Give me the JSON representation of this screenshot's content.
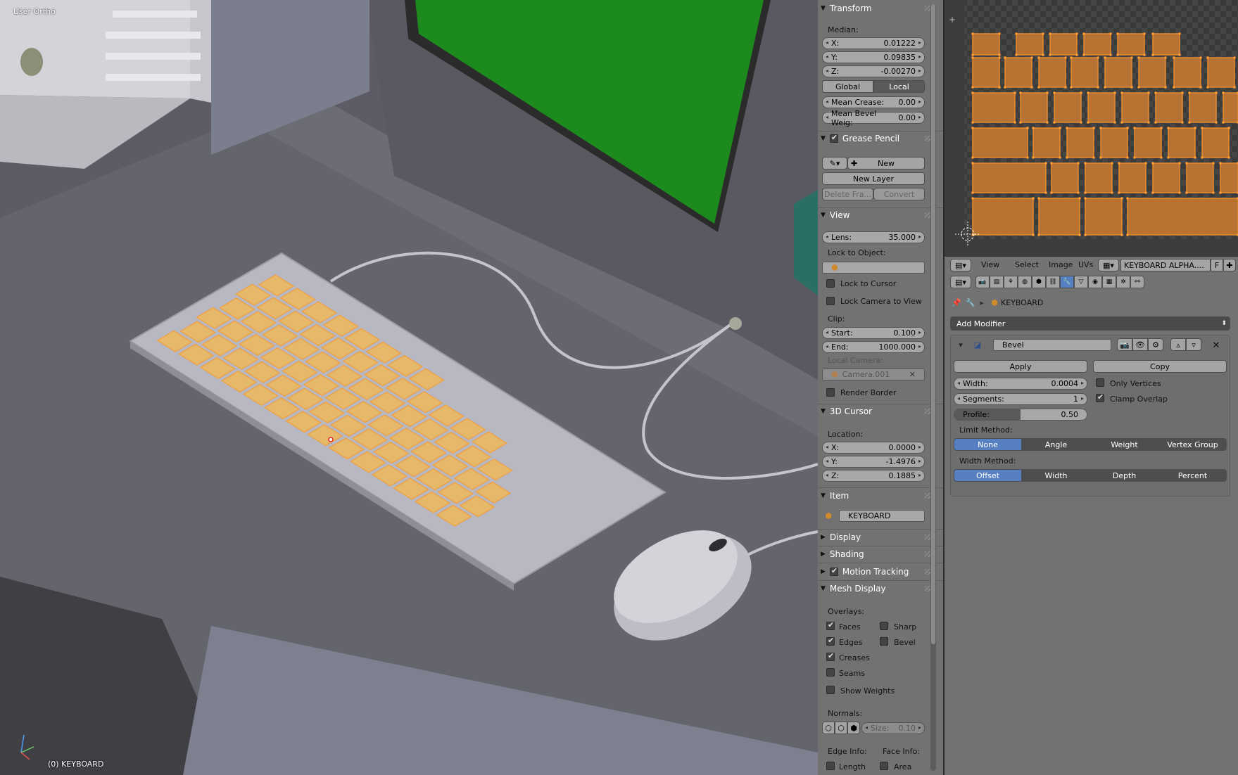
{
  "viewport": {
    "view_name": "User Ortho",
    "object_label": "(0) KEYBOARD"
  },
  "transform": {
    "header": "Transform",
    "median_label": "Median:",
    "x_label": "X:",
    "x_value": "0.01222",
    "y_label": "Y:",
    "y_value": "0.09835",
    "z_label": "Z:",
    "z_value": "-0.00270",
    "global_label": "Global",
    "local_label": "Local",
    "mean_crease_label": "Mean Crease:",
    "mean_crease_value": "0.00",
    "mean_bevel_label": "Mean Bevel Weig:",
    "mean_bevel_value": "0.00"
  },
  "grease_pencil": {
    "header": "Grease Pencil",
    "new_label": "New",
    "new_layer_label": "New Layer",
    "delete_frame_label": "Delete Fra...",
    "convert_label": "Convert"
  },
  "view_panel": {
    "header": "View",
    "lens_label": "Lens:",
    "lens_value": "35.000",
    "lock_to_object_label": "Lock to Object:",
    "lock_to_cursor_label": "Lock to Cursor",
    "lock_camera_label": "Lock Camera to View",
    "clip_label": "Clip:",
    "start_label": "Start:",
    "start_value": "0.100",
    "end_label": "End:",
    "end_value": "1000.000",
    "local_camera_label": "Local Camera:",
    "local_camera_value": "Camera.001",
    "render_border_label": "Render Border"
  },
  "cursor_3d": {
    "header": "3D Cursor",
    "location_label": "Location:",
    "x_label": "X:",
    "x_value": "0.0000",
    "y_label": "Y:",
    "y_value": "-1.4976",
    "z_label": "Z:",
    "z_value": "0.1885"
  },
  "item_panel": {
    "header": "Item",
    "name_value": "KEYBOARD"
  },
  "collapsed_panels": {
    "display": "Display",
    "shading": "Shading",
    "motion_tracking": "Motion Tracking"
  },
  "mesh_display": {
    "header": "Mesh Display",
    "overlays_label": "Overlays:",
    "faces": "Faces",
    "sharp": "Sharp",
    "edges": "Edges",
    "bevel": "Bevel",
    "creases": "Creases",
    "seams": "Seams",
    "show_weights": "Show Weights",
    "normals_label": "Normals:",
    "size_label": "Size:",
    "size_value": "0.10",
    "edge_info_label": "Edge Info:",
    "face_info_label": "Face Info:",
    "length": "Length",
    "area": "Area"
  },
  "uv_header": {
    "view": "View",
    "select": "Select",
    "image": "Image",
    "uvs": "UVs",
    "image_name": "KEYBOARD ALPHA....",
    "f_label": "F"
  },
  "properties": {
    "object_name": "KEYBOARD",
    "add_modifier_label": "Add Modifier",
    "modifier_name": "Bevel",
    "apply_label": "Apply",
    "copy_label": "Copy",
    "width_label": "Width:",
    "width_value": "0.0004",
    "segments_label": "Segments:",
    "segments_value": "1",
    "profile_label": "Profile:",
    "profile_value": "0.50",
    "profile_fill": 0.5,
    "only_vertices_label": "Only Vertices",
    "clamp_overlap_label": "Clamp Overlap",
    "limit_method_label": "Limit Method:",
    "limit_none": "None",
    "limit_angle": "Angle",
    "limit_weight": "Weight",
    "limit_vertex_group": "Vertex Group",
    "width_method_label": "Width Method:",
    "wm_offset": "Offset",
    "wm_width": "Width",
    "wm_depth": "Depth",
    "wm_percent": "Percent"
  },
  "colors": {
    "selection_orange": "#f0a040",
    "accent_blue": "#5680c2",
    "monitor_green": "#1d8a1d"
  }
}
